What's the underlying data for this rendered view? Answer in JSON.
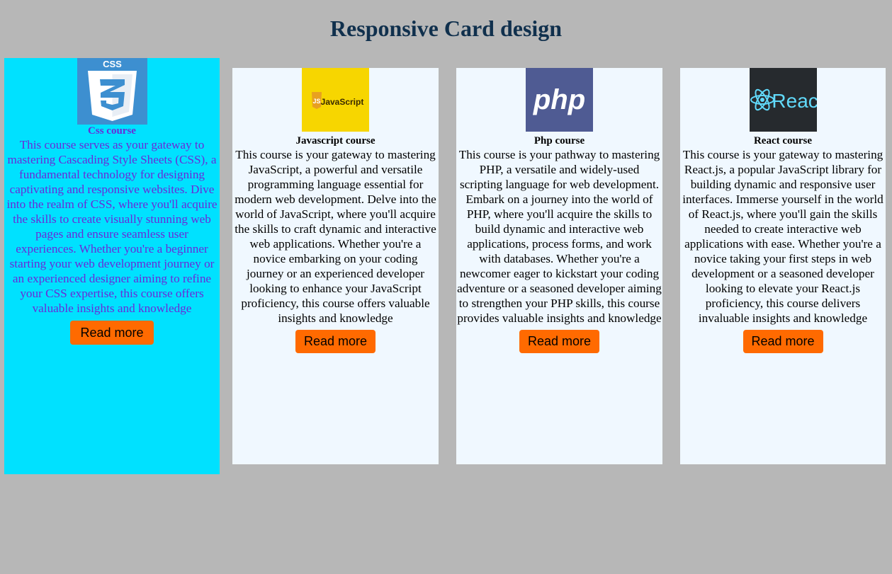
{
  "header": {
    "title": "Responsive Card design"
  },
  "colors": {
    "background": "#b7b7b7",
    "card": "#f0f8ff",
    "active_card": "#00e1ff",
    "active_text": "#6a2bd8",
    "button": "#ff6a00",
    "title": "#10304d"
  },
  "cards": [
    {
      "name": "Css course",
      "icon": "css3-logo",
      "description": "This course serves as your gateway to mastering Cascading Style Sheets (CSS), a fundamental technology for designing captivating and responsive websites. Dive into the realm of CSS, where you'll acquire the skills to create visually stunning web pages and ensure seamless user experiences. Whether you're a beginner starting your web development journey or an experienced designer aiming to refine your CSS expertise, this course offers valuable insights and knowledge",
      "button": "Read more",
      "logo_text": "CSS",
      "logo_digit": "3"
    },
    {
      "name": "Javascript course",
      "icon": "javascript-logo",
      "description": "This course is your gateway to mastering JavaScript, a powerful and versatile programming language essential for modern web development. Delve into the world of JavaScript, where you'll acquire the skills to craft dynamic and interactive web applications. Whether you're a novice embarking on your coding journey or an experienced developer looking to enhance your JavaScript proficiency, this course offers valuable insights and knowledge",
      "button": "Read more",
      "logo_text": "JavaScript",
      "logo_badge": "JS"
    },
    {
      "name": "Php course",
      "icon": "php-logo",
      "description": "This course is your pathway to mastering PHP, a versatile and widely-used scripting language for web development. Embark on a journey into the world of PHP, where you'll acquire the skills to build dynamic and interactive web applications, process forms, and work with databases. Whether you're a newcomer eager to kickstart your coding adventure or a seasoned developer aiming to strengthen your PHP skills, this course provides valuable insights and knowledge",
      "button": "Read more",
      "logo_text": "php"
    },
    {
      "name": "React course",
      "icon": "react-logo",
      "description": "This course is your gateway to mastering React.js, a popular JavaScript library for building dynamic and responsive user interfaces. Immerse yourself in the world of React.js, where you'll gain the skills needed to create interactive web applications with ease. Whether you're a novice taking your first steps in web development or a seasoned developer looking to elevate your React.js proficiency, this course delivers invaluable insights and knowledge",
      "button": "Read more",
      "logo_text": "React"
    }
  ]
}
